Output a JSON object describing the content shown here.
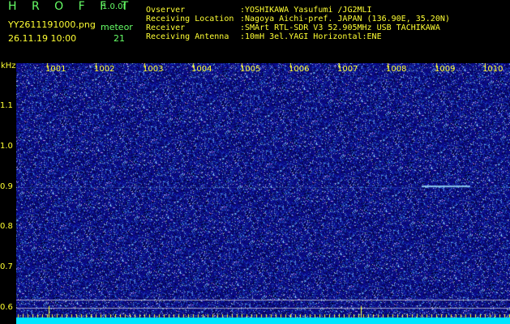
{
  "brand": "H R O F F T",
  "version": "1.0.0f",
  "filename": "YY2611191000.png",
  "datetime": "26.11.19 10:00",
  "meteor_label": "meteor",
  "meteor_count": "21",
  "info": [
    {
      "label": "Ovserver",
      "value": ":YOSHIKAWA Yasufumi /JG2MLI"
    },
    {
      "label": "Receiving Location",
      "value": ":Nagoya Aichi-pref. JAPAN (136.90E, 35.20N)"
    },
    {
      "label": "Receiver",
      "value": ":SMArt RTL-SDR V3 52.905MHz USB TACHIKAWA"
    },
    {
      "label": "Receiving Antenna",
      "value": ":10mH 3el.YAGI Horizontal:ENE"
    }
  ],
  "y_unit": "kHz",
  "y_ticks": [
    "1.1",
    "1.0",
    "0.9",
    "0.8",
    "0.7",
    "0.6"
  ],
  "x_ticks": [
    "1001",
    "1002",
    "1003",
    "1004",
    "1005",
    "1006",
    "1007",
    "1008",
    "1009",
    "1010"
  ],
  "colors": {
    "background": "#000000",
    "waterfall": "#1a1a8c",
    "text_yellow": "#ffff33",
    "text_green": "#66ff66",
    "baseline": "#00e5ff"
  }
}
